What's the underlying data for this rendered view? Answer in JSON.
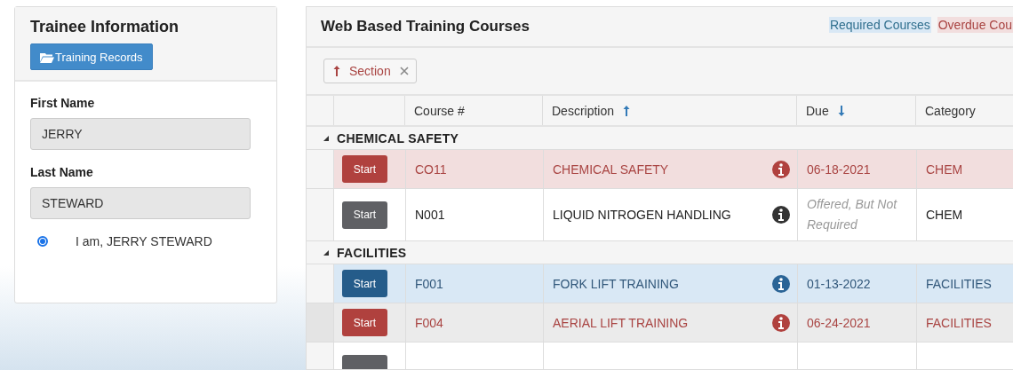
{
  "trainee": {
    "title": "Trainee Information",
    "records_button": "Training Records",
    "fields": [
      {
        "label": "First Name",
        "value": "JERRY"
      },
      {
        "label": "Last Name",
        "value": "STEWARD"
      }
    ],
    "confirm": {
      "label": "I am, JERRY STEWARD",
      "selected": true
    }
  },
  "courses": {
    "title": "Web Based Training Courses",
    "legend": [
      {
        "label": "Required Courses",
        "kind": "required"
      },
      {
        "label": "Overdue Cou",
        "kind": "overdue"
      }
    ],
    "group_chip": {
      "label": "Section",
      "descending": false
    },
    "columns": [
      {
        "label": "Course #",
        "sorted": false
      },
      {
        "label": "Description",
        "sorted": true,
        "descending": false
      },
      {
        "label": "Due",
        "sorted": true,
        "descending": true
      },
      {
        "label": "Category",
        "sorted": false
      }
    ],
    "groups": [
      {
        "name": "CHEMICAL SAFETY",
        "expanded": true,
        "rows": [
          {
            "kind": "overdue",
            "highlighted": false,
            "button": "Start",
            "course": "CO11",
            "description": "CHEMICAL SAFETY",
            "due": "06-18-2021",
            "category": "CHEM"
          },
          {
            "kind": "offered",
            "highlighted": false,
            "button": "Start",
            "course": "N001",
            "description": "LIQUID NITROGEN HANDLING",
            "due": "Offered, But Not Required",
            "category": "CHEM"
          }
        ]
      },
      {
        "name": "FACILITIES",
        "expanded": true,
        "rows": [
          {
            "kind": "required",
            "highlighted": false,
            "button": "Start",
            "course": "F001",
            "description": "FORK LIFT TRAINING",
            "due": "01-13-2022",
            "category": "FACILITIES"
          },
          {
            "kind": "overdue",
            "highlighted": true,
            "button": "Start",
            "course": "F004",
            "description": "AERIAL LIFT TRAINING",
            "due": "06-24-2021",
            "category": "FACILITIES"
          },
          {
            "kind": "offered",
            "highlighted": false
          }
        ]
      }
    ]
  }
}
